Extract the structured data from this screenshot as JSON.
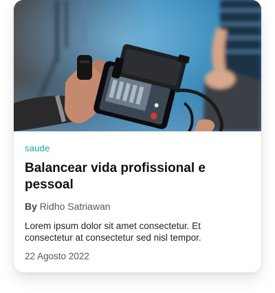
{
  "card": {
    "image_alt": "Hands holding a smartphone on a camera rig",
    "category": "saude",
    "title": "Balancear vida profissional e pessoal",
    "byline_prefix": "By",
    "author": "Ridho Satriawan",
    "excerpt": "Lorem ipsum dolor sit amet consectetur. Et consectetur at consectetur sed nisl tempor.",
    "date": "22 Agosto 2022"
  },
  "colors": {
    "category": "#0fa89b",
    "title": "#111111",
    "text": "#222222",
    "muted": "#555555"
  }
}
